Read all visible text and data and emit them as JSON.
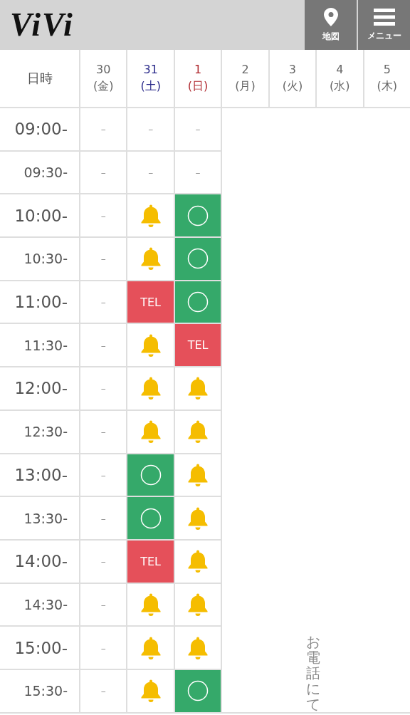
{
  "header": {
    "logo": "ViVi",
    "buttons": [
      {
        "kind": "map",
        "label": "地図"
      },
      {
        "kind": "menu",
        "label": "メニュー"
      }
    ]
  },
  "table": {
    "corner": "日時",
    "days": [
      {
        "day": "30",
        "weekday": "(金)",
        "color": "#666666"
      },
      {
        "day": "31",
        "weekday": "(土)",
        "color": "#2a2a8a"
      },
      {
        "day": "1",
        "weekday": "(日)",
        "color": "#b02a30"
      },
      {
        "day": "2",
        "weekday": "(月)",
        "color": "#666666"
      },
      {
        "day": "3",
        "weekday": "(火)",
        "color": "#666666"
      },
      {
        "day": "4",
        "weekday": "(水)",
        "color": "#666666"
      },
      {
        "day": "5",
        "weekday": "(木)",
        "color": "#666666"
      }
    ],
    "rows": [
      {
        "time": "09:00-",
        "hour": true,
        "slots": [
          {
            "kind": "dash",
            "text": "–"
          },
          {
            "kind": "dash",
            "text": "–"
          },
          {
            "kind": "dash",
            "text": "–"
          }
        ]
      },
      {
        "time": "09:30-",
        "hour": false,
        "slots": [
          {
            "kind": "dash",
            "text": "–"
          },
          {
            "kind": "dash",
            "text": "–"
          },
          {
            "kind": "dash",
            "text": "–"
          }
        ]
      },
      {
        "time": "10:00-",
        "hour": true,
        "slots": [
          {
            "kind": "dash",
            "text": "–"
          },
          {
            "kind": "bell"
          },
          {
            "kind": "ok"
          }
        ]
      },
      {
        "time": "10:30-",
        "hour": false,
        "slots": [
          {
            "kind": "dash",
            "text": "–"
          },
          {
            "kind": "bell"
          },
          {
            "kind": "ok"
          }
        ]
      },
      {
        "time": "11:00-",
        "hour": true,
        "slots": [
          {
            "kind": "dash",
            "text": "–"
          },
          {
            "kind": "tel",
            "text": "TEL"
          },
          {
            "kind": "ok"
          }
        ]
      },
      {
        "time": "11:30-",
        "hour": false,
        "slots": [
          {
            "kind": "dash",
            "text": "–"
          },
          {
            "kind": "bell"
          },
          {
            "kind": "tel",
            "text": "TEL"
          }
        ]
      },
      {
        "time": "12:00-",
        "hour": true,
        "slots": [
          {
            "kind": "dash",
            "text": "–"
          },
          {
            "kind": "bell"
          },
          {
            "kind": "bell"
          }
        ]
      },
      {
        "time": "12:30-",
        "hour": false,
        "slots": [
          {
            "kind": "dash",
            "text": "–"
          },
          {
            "kind": "bell"
          },
          {
            "kind": "bell"
          }
        ]
      },
      {
        "time": "13:00-",
        "hour": true,
        "slots": [
          {
            "kind": "dash",
            "text": "–"
          },
          {
            "kind": "ok"
          },
          {
            "kind": "bell"
          }
        ]
      },
      {
        "time": "13:30-",
        "hour": false,
        "slots": [
          {
            "kind": "dash",
            "text": "–"
          },
          {
            "kind": "ok"
          },
          {
            "kind": "bell"
          }
        ]
      },
      {
        "time": "14:00-",
        "hour": true,
        "slots": [
          {
            "kind": "dash",
            "text": "–"
          },
          {
            "kind": "tel",
            "text": "TEL"
          },
          {
            "kind": "bell"
          }
        ]
      },
      {
        "time": "14:30-",
        "hour": false,
        "slots": [
          {
            "kind": "dash",
            "text": "–"
          },
          {
            "kind": "bell"
          },
          {
            "kind": "bell"
          }
        ]
      },
      {
        "time": "15:00-",
        "hour": true,
        "slots": [
          {
            "kind": "dash",
            "text": "–"
          },
          {
            "kind": "bell"
          },
          {
            "kind": "bell"
          }
        ]
      },
      {
        "time": "15:30-",
        "hour": false,
        "slots": [
          {
            "kind": "dash",
            "text": "–"
          },
          {
            "kind": "bell"
          },
          {
            "kind": "ok"
          }
        ]
      }
    ],
    "phone_note": "お電話にて"
  }
}
